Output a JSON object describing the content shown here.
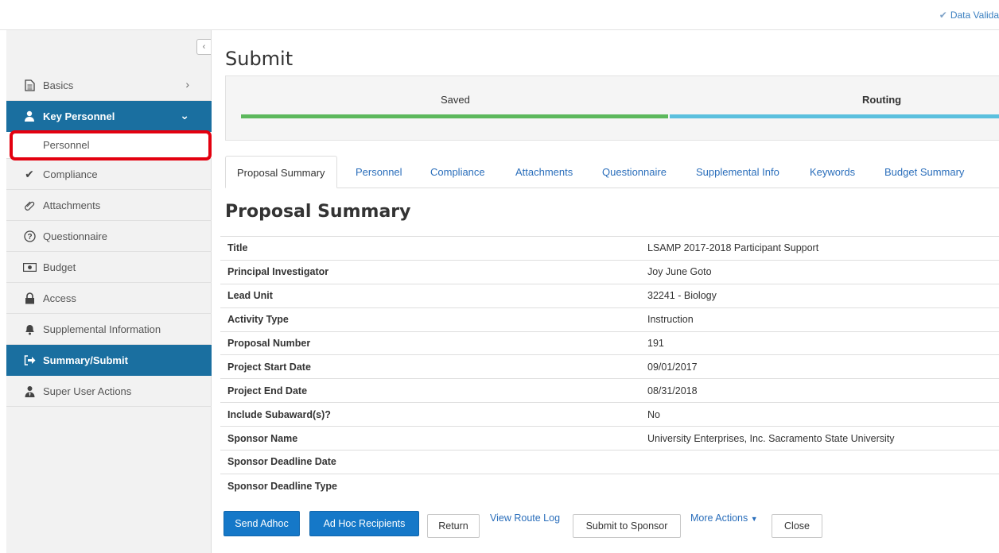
{
  "topbar": {
    "data_validation": "Data Valida"
  },
  "sidebar": {
    "collapse_glyph": "‹",
    "items": [
      {
        "label": "Basics",
        "icon": "document-icon",
        "chevron": "›"
      },
      {
        "label": "Key Personnel",
        "icon": "person-icon",
        "chevron": "⌄"
      },
      {
        "label": "Compliance",
        "icon": "checkmark-icon"
      },
      {
        "label": "Attachments",
        "icon": "paperclip-icon"
      },
      {
        "label": "Questionnaire",
        "icon": "question-circle-icon"
      },
      {
        "label": "Budget",
        "icon": "money-icon"
      },
      {
        "label": "Access",
        "icon": "lock-icon"
      },
      {
        "label": "Supplemental Information",
        "icon": "bell-icon"
      },
      {
        "label": "Summary/Submit",
        "icon": "arrow-right-icon"
      },
      {
        "label": "Super User Actions",
        "icon": "user-tie-icon"
      }
    ],
    "sub_item": "Personnel"
  },
  "main": {
    "title": "Submit",
    "progress": {
      "step1": "Saved",
      "step2": "Routing"
    },
    "tabs": [
      "Proposal Summary",
      "Personnel",
      "Compliance",
      "Attachments",
      "Questionnaire",
      "Supplemental Info",
      "Keywords",
      "Budget Summary"
    ],
    "section_title": "Proposal Summary",
    "summary": [
      {
        "key": "Title",
        "value": "LSAMP 2017-2018 Participant Support"
      },
      {
        "key": "Principal Investigator",
        "value": "Joy June Goto"
      },
      {
        "key": "Lead Unit",
        "value": "32241 - Biology"
      },
      {
        "key": "Activity Type",
        "value": "Instruction"
      },
      {
        "key": "Proposal Number",
        "value": "191"
      },
      {
        "key": "Project Start Date",
        "value": "09/01/2017"
      },
      {
        "key": "Project End Date",
        "value": "08/31/2018"
      },
      {
        "key": "Include Subaward(s)?",
        "value": "No"
      },
      {
        "key": "Sponsor Name",
        "value": "University Enterprises, Inc. Sacramento State University"
      },
      {
        "key": "Sponsor Deadline Date",
        "value": ""
      },
      {
        "key": "Sponsor Deadline Type",
        "value": ""
      }
    ],
    "actions": {
      "send_adhoc": "Send Adhoc",
      "ad_hoc_recipients": "Ad Hoc Recipients",
      "return": "Return",
      "view_route_log": "View Route Log",
      "submit_to_sponsor": "Submit to Sponsor",
      "more_actions": "More Actions",
      "close": "Close"
    }
  },
  "colors": {
    "nav_active": "#1a6fa0",
    "saved_bar": "#5cb85c",
    "routing_bar": "#5bc0de",
    "primary_button": "#1578c8",
    "highlight": "#e3000f"
  }
}
